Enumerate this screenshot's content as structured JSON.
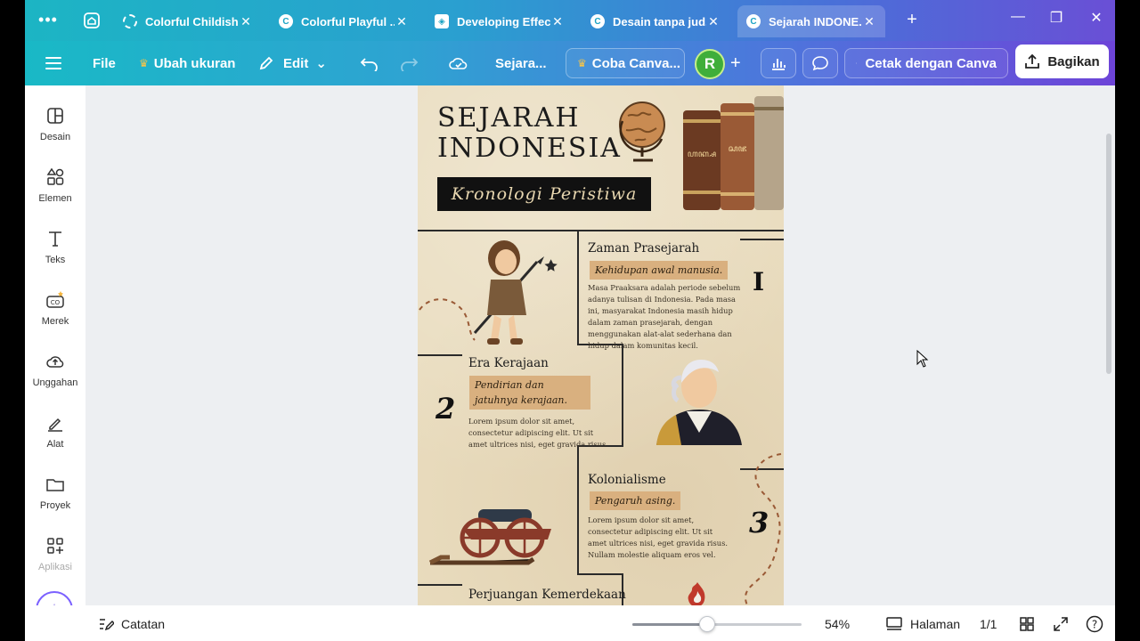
{
  "tabs": [
    {
      "label": "Colorful Childish...",
      "icon": "loading-icon"
    },
    {
      "label": "Colorful Playful ...",
      "icon": "canva-icon"
    },
    {
      "label": "Developing Effec...",
      "icon": "shield-icon"
    },
    {
      "label": "Desain tanpa jud...",
      "icon": "canva-icon"
    },
    {
      "label": "Sejarah INDONE...",
      "icon": "canva-icon",
      "active": true
    }
  ],
  "toolbar": {
    "file": "File",
    "resize": "Ubah ukuran",
    "edit": "Edit",
    "doc_title": "Sejara...",
    "try_canva": "Coba Canva...",
    "avatar_initial": "R",
    "print": "Cetak dengan Canva",
    "share": "Bagikan"
  },
  "sidebar": {
    "items": [
      {
        "label": "Desain",
        "icon": "design-icon"
      },
      {
        "label": "Elemen",
        "icon": "elements-icon"
      },
      {
        "label": "Teks",
        "icon": "text-icon"
      },
      {
        "label": "Merek",
        "icon": "brand-icon"
      },
      {
        "label": "Unggahan",
        "icon": "upload-cloud-icon"
      },
      {
        "label": "Alat",
        "icon": "tools-icon"
      },
      {
        "label": "Proyek",
        "icon": "folder-icon"
      },
      {
        "label": "Aplikasi",
        "icon": "apps-icon"
      }
    ]
  },
  "poster": {
    "title_line1": "SEJARAH",
    "title_line2": "INDONESIA",
    "subtitle": "Kronologi Peristiwa",
    "sections": [
      {
        "title": "Zaman Prasejarah",
        "tag": "Kehidupan awal manusia.",
        "number": "I",
        "body": "Masa Praaksara adalah periode sebelum adanya tulisan di Indonesia. Pada masa ini, masyarakat Indonesia masih hidup dalam zaman prasejarah, dengan menggunakan alat-alat sederhana dan hidup dalam komunitas kecil."
      },
      {
        "title": "Era Kerajaan",
        "tag": "Pendirian dan jatuhnya kerajaan.",
        "number": "2",
        "body": "Lorem ipsum dolor sit amet, consectetur adipiscing elit. Ut sit amet ultrices nisi, eget gravida risus."
      },
      {
        "title": "Kolonialisme",
        "tag": "Pengaruh asing.",
        "number": "3",
        "body": "Lorem ipsum dolor sit amet, consectetur adipiscing elit. Ut sit amet ultrices nisi, eget gravida risus. Nullam molestie aliquam eros vel."
      },
      {
        "title": "Perjuangan Kemerdekaan"
      }
    ]
  },
  "bottombar": {
    "notes": "Catatan",
    "zoom": "54%",
    "zoom_fraction": 0.44,
    "pages_label": "Halaman",
    "page_count": "1/1"
  },
  "colors": {
    "accent_teal": "#1cb5c4",
    "accent_purple": "#6d44d8",
    "poster_bg": "#e9dcbe",
    "tag_bg": "#d9b07f"
  }
}
